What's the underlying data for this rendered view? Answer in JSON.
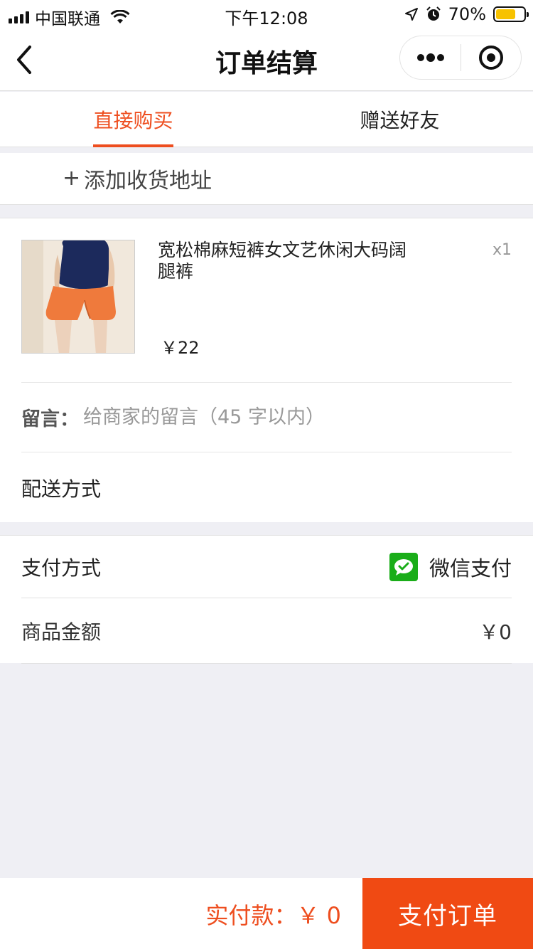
{
  "status_bar": {
    "carrier": "中国联通",
    "time": "下午12:08",
    "battery": "70%",
    "battery_level": 0.7
  },
  "nav": {
    "title": "订单结算"
  },
  "tabs": [
    {
      "label": "直接购买",
      "active": true
    },
    {
      "label": "赠送好友",
      "active": false
    }
  ],
  "address": {
    "plus": "+",
    "label": "添加收货地址"
  },
  "product": {
    "name": "宽松棉麻短裤女文艺休闲大码阔腿裤",
    "quantity": "x1",
    "price": "￥22"
  },
  "message": {
    "label": "留言：",
    "placeholder": "给商家的留言（45 字以内）",
    "value": ""
  },
  "delivery": {
    "label": "配送方式"
  },
  "payment": {
    "label": "支付方式",
    "method": "微信支付",
    "method_icon": "wechat-pay-icon"
  },
  "amount": {
    "label": "商品金额",
    "value": "￥0"
  },
  "bottom": {
    "total_text": "实付款：￥ 0",
    "submit_label": "支付订单"
  },
  "colors": {
    "accent": "#ee4e1f",
    "submit_bg": "#f04a13",
    "wechat_green": "#1aad19",
    "page_bg": "#efeff4"
  }
}
